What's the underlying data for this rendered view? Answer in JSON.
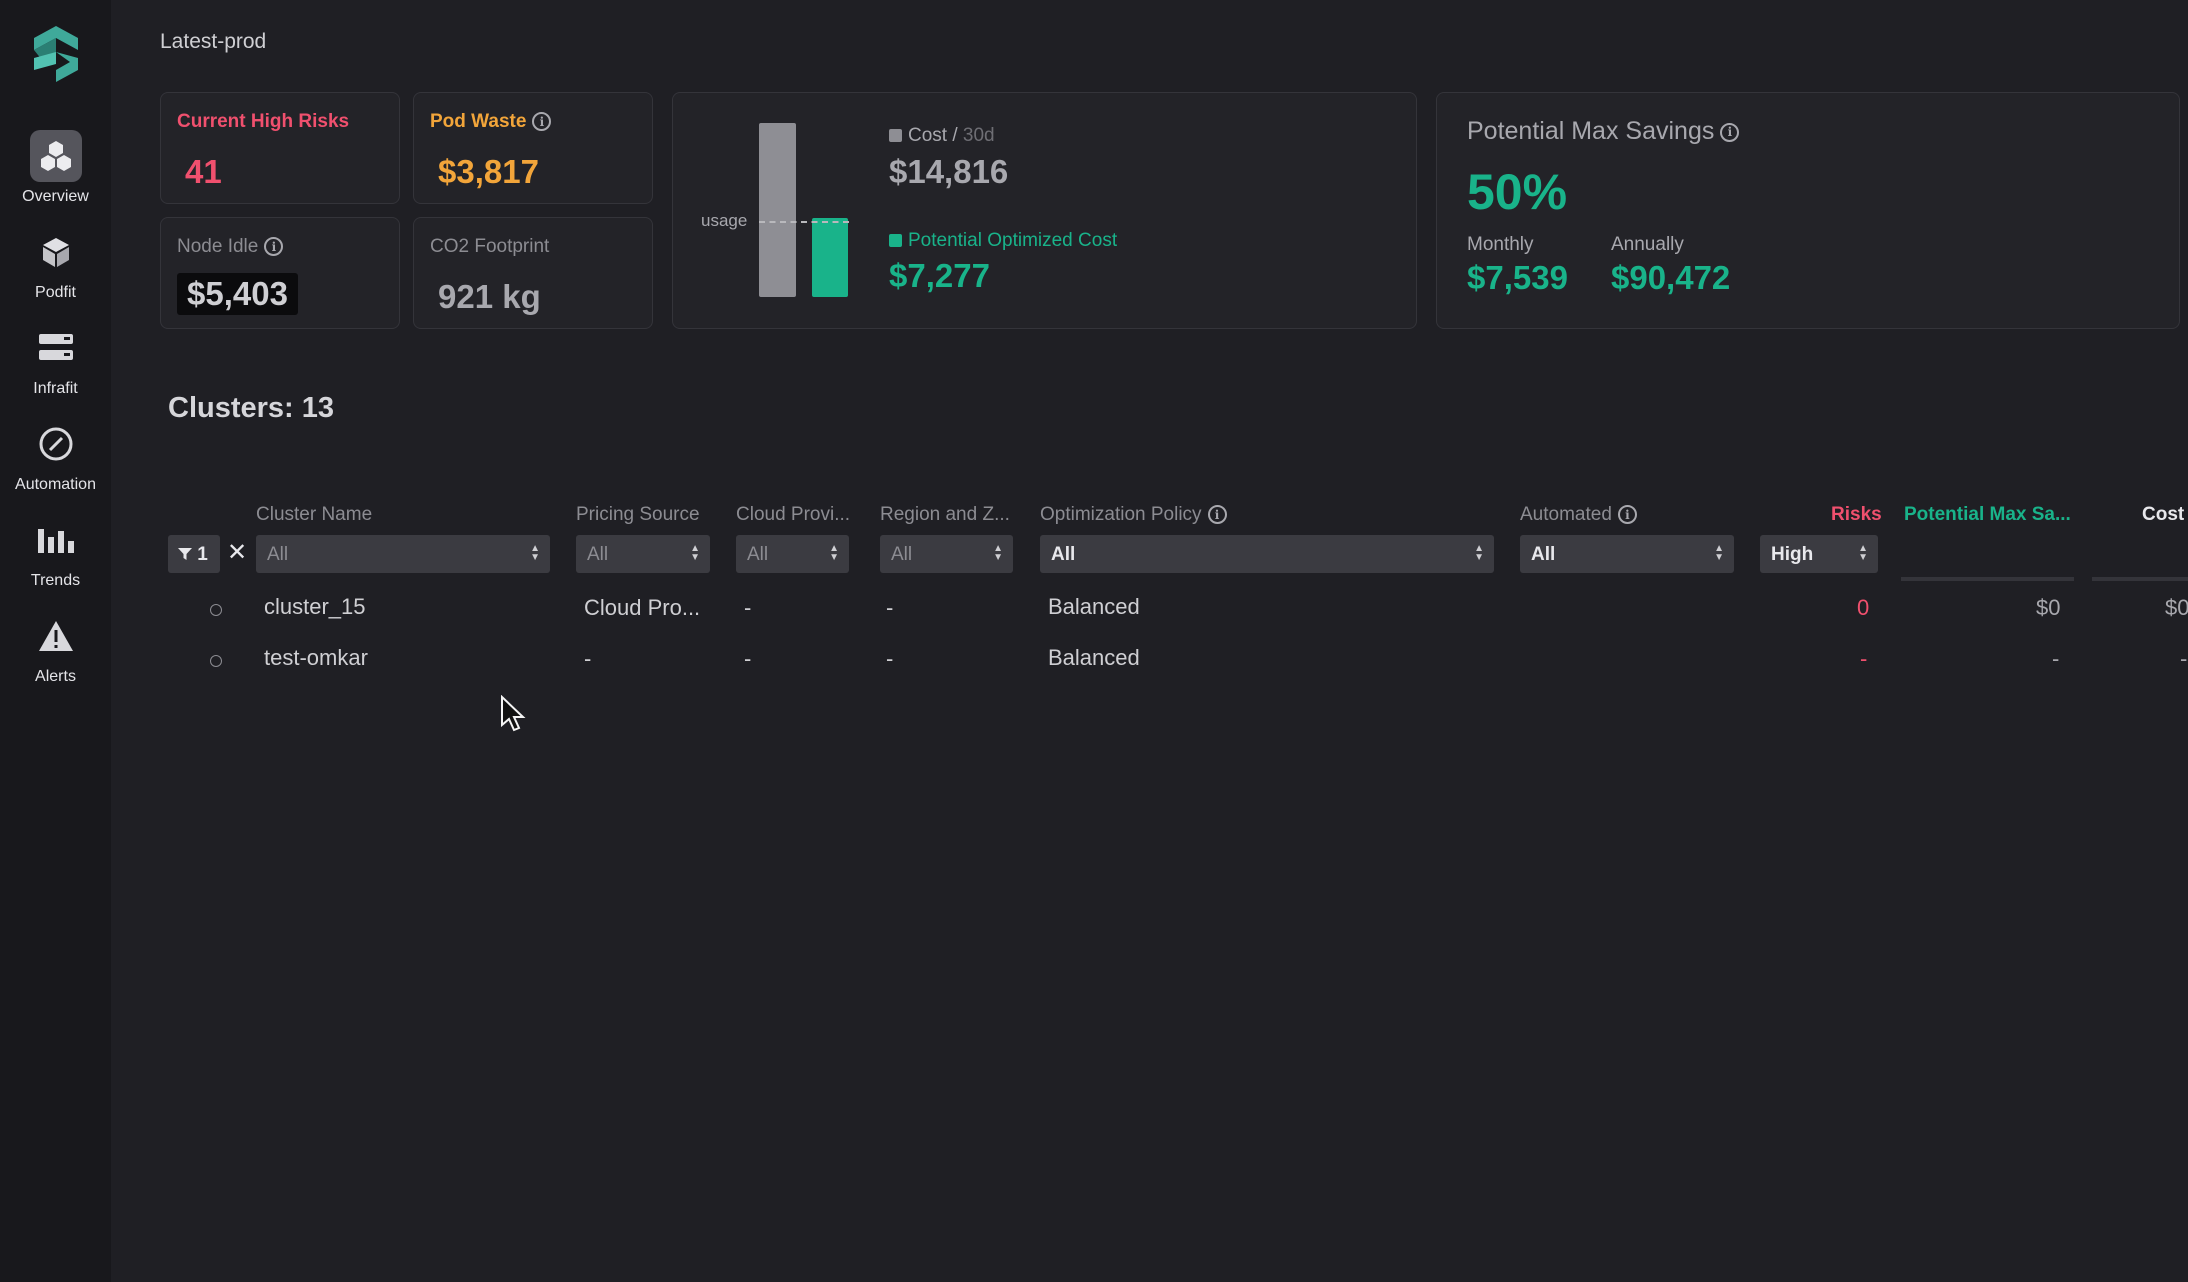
{
  "sidebar": {
    "items": [
      {
        "label": "Overview",
        "icon": "cubes-icon",
        "active": true
      },
      {
        "label": "Podfit",
        "icon": "cube-icon"
      },
      {
        "label": "Infrafit",
        "icon": "server-icon"
      },
      {
        "label": "Automation",
        "icon": "gauge-icon"
      },
      {
        "label": "Trends",
        "icon": "bar-chart-icon"
      },
      {
        "label": "Alerts",
        "icon": "warning-icon"
      }
    ]
  },
  "page": {
    "title": "Latest-prod"
  },
  "stats": {
    "high_risks": {
      "label": "Current High Risks",
      "value": "41"
    },
    "pod_waste": {
      "label": "Pod Waste",
      "value": "$3,817"
    },
    "node_idle": {
      "label": "Node Idle",
      "value": "$5,403"
    },
    "co2": {
      "label": "CO2 Footprint",
      "value": "921 kg"
    }
  },
  "cost_card": {
    "usage_label": "usage",
    "cost_label": "Cost",
    "cost_period": "30d",
    "cost_value": "$14,816",
    "optimized_label": "Potential Optimized Cost",
    "optimized_value": "$7,277",
    "usage_fraction": 0.56,
    "optimized_fraction": 0.49
  },
  "savings": {
    "title": "Potential Max Savings",
    "percent": "50%",
    "monthly_label": "Monthly",
    "monthly_value": "$7,539",
    "annually_label": "Annually",
    "annually_value": "$90,472"
  },
  "clusters": {
    "title": "Clusters: 13",
    "filter_count": "1",
    "columns": {
      "name": "Cluster Name",
      "pricing": "Pricing Source",
      "cloud": "Cloud Provi...",
      "region": "Region and Z...",
      "policy": "Optimization Policy",
      "automated": "Automated",
      "risks": "Risks",
      "savings": "Potential Max Sa...",
      "cost": "Cost"
    },
    "filters": {
      "name": "All",
      "pricing": "All",
      "cloud": "All",
      "region": "All",
      "policy": "All",
      "automated": "All",
      "risks": "High"
    },
    "rows": [
      {
        "name": "cluster_15",
        "pricing": "Cloud Pro...",
        "cloud": "-",
        "region": "-",
        "policy": "Balanced",
        "risks": "0",
        "savings": "$0",
        "cost": "$0"
      },
      {
        "name": "test-omkar",
        "pricing": "-",
        "cloud": "-",
        "region": "-",
        "policy": "Balanced",
        "risks": "-",
        "savings": "-",
        "cost": "-"
      }
    ]
  },
  "colors": {
    "accent_green": "#19b38a",
    "risk_red": "#f0506e",
    "waste_orange": "#f2a53a"
  }
}
